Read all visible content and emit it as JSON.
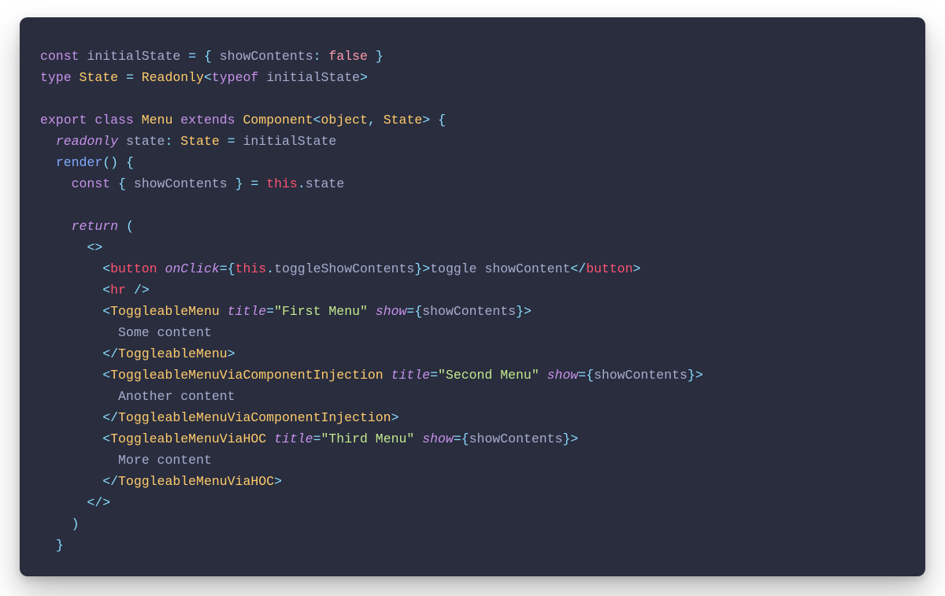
{
  "colors": {
    "background": "#292d3e",
    "foreground": "#a6accd",
    "keyword": "#c792ea",
    "type": "#ffcb6b",
    "function": "#82aaff",
    "operator": "#89ddff",
    "string": "#c3e88d",
    "boolean": "#ff9cac",
    "this": "#ff5370"
  },
  "l1": {
    "const": "const",
    "name": "initialState",
    "eq": "=",
    "lb": "{",
    "prop": "showContents",
    "colon": ":",
    "val": "false",
    "rb": "}"
  },
  "l2": {
    "type_kw": "type",
    "name": "State",
    "eq": "=",
    "readonly": "Readonly",
    "lt": "<",
    "typeof": "typeof",
    "ref": "initialState",
    "gt": ">"
  },
  "l4": {
    "export": "export",
    "class": "class",
    "name": "Menu",
    "extends": "extends",
    "comp": "Component",
    "lt": "<",
    "obj": "object",
    "comma": ",",
    "state": "State",
    "gt": ">",
    "lb": "{"
  },
  "l5": {
    "readonly": "readonly",
    "state": "state",
    "colon": ":",
    "type": "State",
    "eq": "=",
    "val": "initialState"
  },
  "l6": {
    "render": "render",
    "paren": "()",
    "lb": "{"
  },
  "l7": {
    "const": "const",
    "lb": "{",
    "name": "showContents",
    "rb": "}",
    "eq": "=",
    "this": "this",
    "dot": ".",
    "state": "state"
  },
  "l9": {
    "return": "return",
    "lp": "("
  },
  "l10": {
    "open": "<>"
  },
  "l11": {
    "lt": "<",
    "tag": "button",
    "sp": " ",
    "attr": "onClick",
    "eq": "=",
    "lb": "{",
    "this": "this",
    "dot": ".",
    "method": "toggleShowContents",
    "rb": "}",
    "gt": ">",
    "text": "toggle showContent",
    "clt": "</",
    "ctag": "button",
    "cgt": ">"
  },
  "l12": {
    "lt": "<",
    "tag": "hr",
    "slashgt": "/>"
  },
  "l13": {
    "lt": "<",
    "tag": "ToggleableMenu",
    "a1": "title",
    "eq1": "=",
    "v1": "\"First Menu\"",
    "a2": "show",
    "eq2": "=",
    "lb": "{",
    "expr": "showContents",
    "rb": "}",
    "gt": ">"
  },
  "l14": {
    "text": "Some content"
  },
  "l15": {
    "clt": "</",
    "tag": "ToggleableMenu",
    "gt": ">"
  },
  "l16": {
    "lt": "<",
    "tag": "ToggleableMenuViaComponentInjection",
    "a1": "title",
    "eq1": "=",
    "v1": "\"Second Menu\"",
    "a2": "show",
    "eq2": "=",
    "lb": "{",
    "expr": "showContents",
    "rb": "}",
    "gt": ">"
  },
  "l17": {
    "text": "Another content"
  },
  "l18": {
    "clt": "</",
    "tag": "ToggleableMenuViaComponentInjection",
    "gt": ">"
  },
  "l19": {
    "lt": "<",
    "tag": "ToggleableMenuViaHOC",
    "a1": "title",
    "eq1": "=",
    "v1": "\"Third Menu\"",
    "a2": "show",
    "eq2": "=",
    "lb": "{",
    "expr": "showContents",
    "rb": "}",
    "gt": ">"
  },
  "l20": {
    "text": "More content"
  },
  "l21": {
    "clt": "</",
    "tag": "ToggleableMenuViaHOC",
    "gt": ">"
  },
  "l22": {
    "close": "</>"
  },
  "l23": {
    "rp": ")"
  },
  "l24": {
    "rb": "}"
  }
}
